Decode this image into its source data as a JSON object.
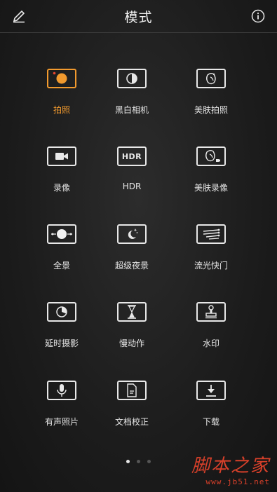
{
  "header": {
    "title": "模式"
  },
  "modes": [
    {
      "label": "拍照",
      "icon": "camera-record-icon",
      "active": true
    },
    {
      "label": "黑白相机",
      "icon": "monochrome-icon",
      "active": false
    },
    {
      "label": "美肤拍照",
      "icon": "beauty-photo-icon",
      "active": false
    },
    {
      "label": "录像",
      "icon": "video-camera-icon",
      "active": false
    },
    {
      "label": "HDR",
      "icon": "hdr-icon",
      "icon_text": "HDR",
      "active": false
    },
    {
      "label": "美肤录像",
      "icon": "beauty-video-icon",
      "active": false
    },
    {
      "label": "全景",
      "icon": "panorama-icon",
      "active": false
    },
    {
      "label": "超级夜景",
      "icon": "night-moon-icon",
      "active": false
    },
    {
      "label": "流光快门",
      "icon": "light-trail-icon",
      "active": false
    },
    {
      "label": "延时摄影",
      "icon": "timelapse-icon",
      "active": false
    },
    {
      "label": "慢动作",
      "icon": "hourglass-icon",
      "active": false
    },
    {
      "label": "水印",
      "icon": "stamp-icon",
      "active": false
    },
    {
      "label": "有声照片",
      "icon": "microphone-icon",
      "active": false
    },
    {
      "label": "文档校正",
      "icon": "document-icon",
      "active": false
    },
    {
      "label": "下载",
      "icon": "download-icon",
      "active": false
    }
  ],
  "pagination": {
    "pages": 3,
    "current": 1
  },
  "watermark": {
    "main": "脚本之家",
    "sub": "www.jb51.net"
  },
  "colors": {
    "accent": "#f29a2e",
    "watermark": "#d8402a"
  }
}
